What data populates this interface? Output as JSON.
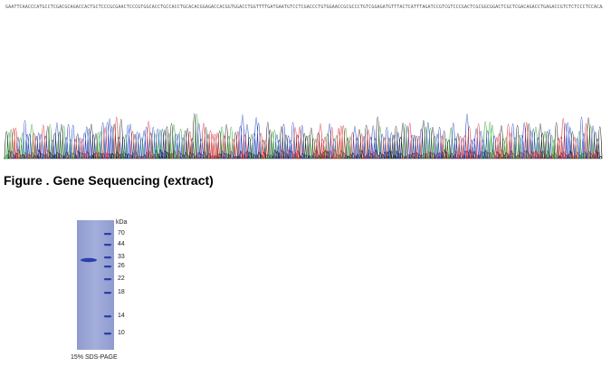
{
  "sequence": {
    "text": "GAATTCAACCCATGCCTCGACGCAGACCACTGCTCCCGCGAACTCCCGTGGCACCTGCCACCTGCACACGGAGACCACGGTGGACCTGGTTTTGATGAATGTCCTCGACCCTGTGGAACCGCGCCCTGTCGGAGATGTTTACTCATTTAGATCCGTCGTCCCGACTCGCGGCGGACTCGCTCGACAGACCTGAGACCGTCTCTCCCTCCACAACTTGAATTCAGACCTGCCACGGAGCAAGTTTCCCGTCACCTGACGGGACACGGTCTCGG"
  },
  "chromatogram_colors": {
    "A": "#2ca02c",
    "C": "#1f3fbf",
    "G": "#222222",
    "T": "#d62728"
  },
  "figure": {
    "caption": "Figure . Gene Sequencing (extract)"
  },
  "gel": {
    "unit_label": "kDa",
    "markers": [
      "70",
      "44",
      "33",
      "26",
      "22",
      "18",
      "14",
      "10"
    ],
    "caption": "15% SDS-PAGE",
    "gel_color": "#9aa6d4",
    "band_color": "#2a3fa8"
  }
}
